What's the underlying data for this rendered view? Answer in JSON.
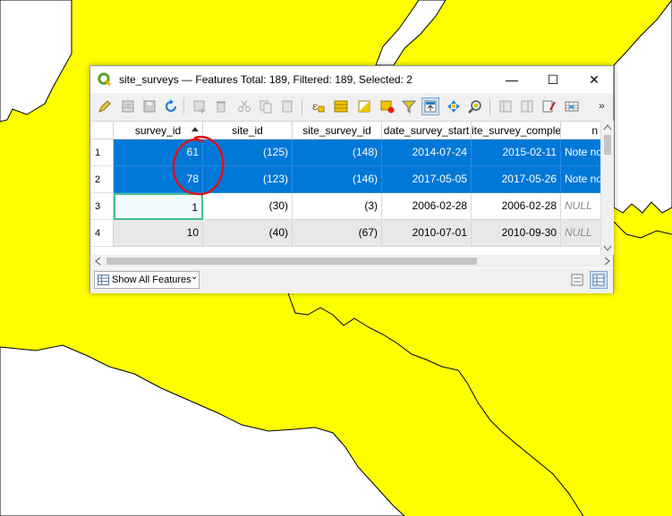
{
  "window": {
    "title": "site_surveys — Features Total: 189, Filtered: 189, Selected: 2",
    "minimize": "—",
    "maximize": "☐",
    "close": "✕"
  },
  "toolbar": {
    "tools": [
      "pencil-icon",
      "multi-edit-icon",
      "save-edits-icon",
      "reload-icon",
      "add-feature-icon",
      "delete-feature-icon",
      "cut-icon",
      "copy-icon",
      "paste-icon",
      "expression-select-icon",
      "select-all-icon",
      "invert-selection-icon",
      "deselect-icon",
      "filter-icon",
      "move-selection-top-icon",
      "pan-to-selection-icon",
      "zoom-to-selection-icon",
      "new-field-icon",
      "delete-field-icon",
      "field-calculator-icon",
      "conditional-format-icon"
    ],
    "more_label": "»"
  },
  "table": {
    "columns": [
      "survey_id",
      "site_id",
      "site_survey_id",
      "date_survey_start",
      "ite_survey_comple",
      "n"
    ],
    "rows": [
      {
        "num": "1",
        "survey_id": "61",
        "site_id": "(125)",
        "site_survey_id": "(148)",
        "date_start": "2014-07-24",
        "date_complete": "2015-02-11",
        "notes": "Note no",
        "selected": true
      },
      {
        "num": "2",
        "survey_id": "78",
        "site_id": "(123)",
        "site_survey_id": "(146)",
        "date_start": "2017-05-05",
        "date_complete": "2017-05-26",
        "notes": "Note no",
        "selected": true
      },
      {
        "num": "3",
        "survey_id": "1",
        "site_id": "(30)",
        "site_survey_id": "(3)",
        "date_start": "2006-02-28",
        "date_complete": "2006-02-28",
        "notes": "NULL",
        "selected": false
      },
      {
        "num": "4",
        "survey_id": "10",
        "site_id": "(40)",
        "site_survey_id": "(67)",
        "date_start": "2010-07-01",
        "date_complete": "2010-09-30",
        "notes": "NULL",
        "selected": false
      }
    ]
  },
  "footer": {
    "show_features_label": "Show All Features",
    "dropdown_arrow": "⌄"
  },
  "colors": {
    "map_fill": "#ffff00",
    "selection": "#0078d7",
    "annotation": "#e0101a",
    "focus_border": "#41c08d"
  }
}
